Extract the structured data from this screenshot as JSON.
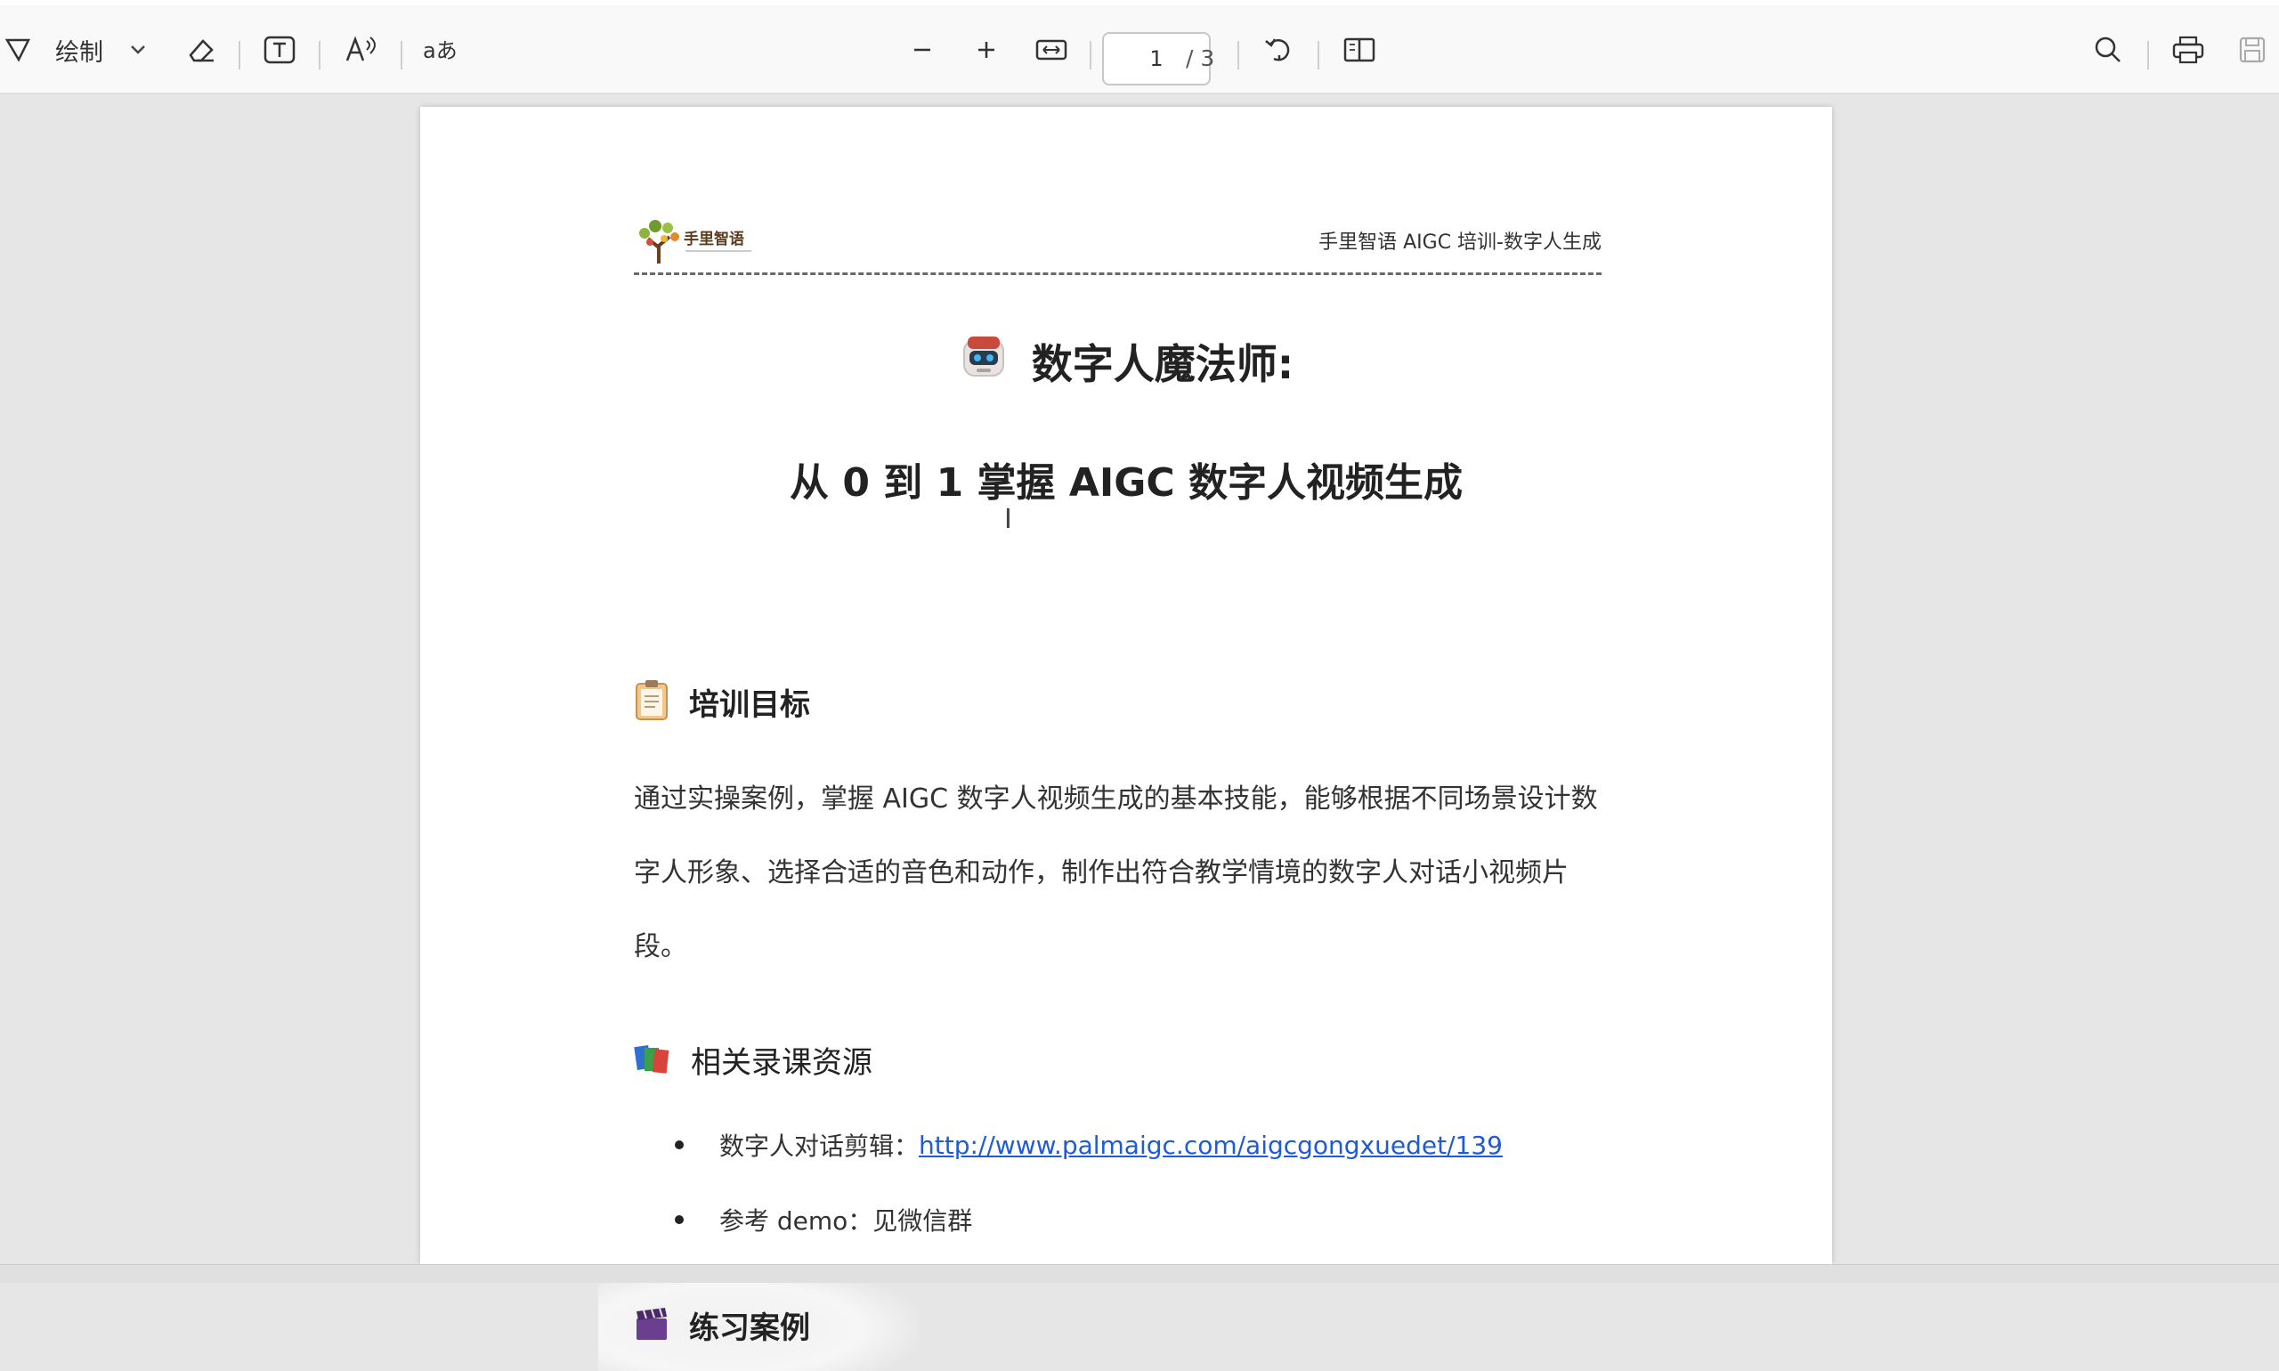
{
  "toolbar": {
    "draw_label": "绘制",
    "page_current": "1",
    "page_total": "/ 3"
  },
  "header": {
    "logo_text": "手里智语",
    "title": "手里智语 AIGC 培训-数字人生成"
  },
  "doc": {
    "title_line1": "数字人魔法师:",
    "title_line2": "从 0 到 1 掌握 AIGC 数字人视频生成",
    "section_goal": "培训目标",
    "goal_para": "通过实操案例，掌握 AIGC 数字人视频生成的基本技能，能够根据不同场景设计数字人形象、选择合适的音色和动作，制作出符合教学情境的数字人对话小视频片段。",
    "section_resources": "相关录课资源",
    "resources": [
      {
        "label": "数字人对话剪辑：",
        "link": "http://www.palmaigc.com/aigcgongxuedet/139"
      },
      {
        "label": "参考 demo：见微信群",
        "link": ""
      }
    ],
    "section_practice": "练习案例"
  },
  "icons": {
    "filter": "draw-icon",
    "eraser": "eraser-icon",
    "text": "text-box-icon",
    "read_aloud": "read-aloud-icon",
    "translate": "translate-icon",
    "zoom_out": "minus-icon",
    "zoom_in": "plus-icon",
    "fit": "fit-page-icon",
    "rotate": "rotate-icon",
    "two_page": "two-page-icon",
    "search": "search-icon",
    "print": "print-icon",
    "save": "save-icon"
  },
  "colors": {
    "link": "#1f5bd6",
    "page_bg": "#ffffff",
    "viewer_bg": "#e6e6e6"
  }
}
